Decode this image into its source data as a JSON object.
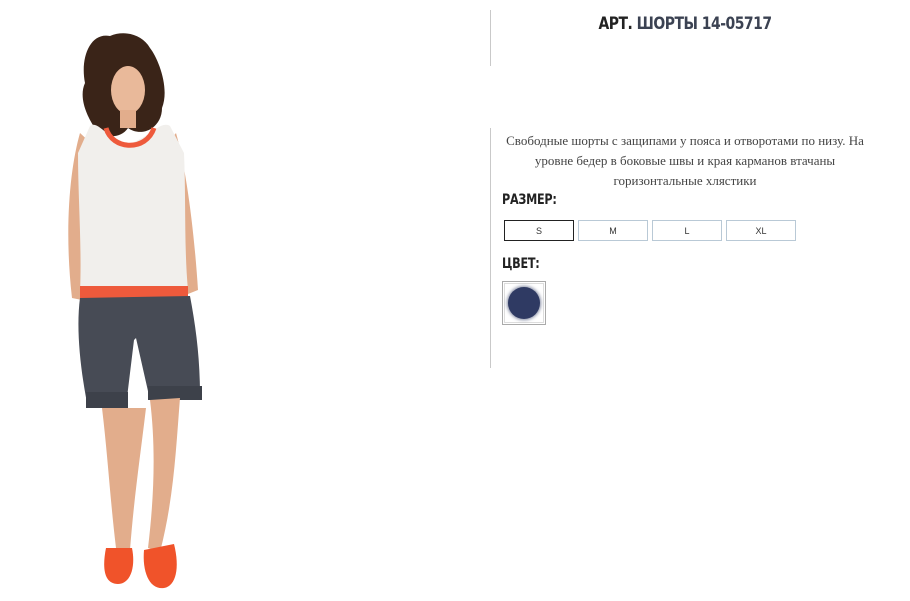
{
  "product": {
    "title_prefix": "АРТ.",
    "title_name": "ШОРТЫ 14-05717",
    "description": "Свободные шорты с защипами у пояса и отворотами по низу. На уровне бедер в боковые швы и края карманов втачаны горизонтальные хлястики"
  },
  "size": {
    "label": "РАЗМЕР:",
    "options": [
      "S",
      "M",
      "L",
      "XL"
    ],
    "selected": "S"
  },
  "color": {
    "label": "ЦВЕТ:",
    "swatch_hex": "#2f3a63"
  },
  "photo": {
    "icon": "model-photo"
  }
}
